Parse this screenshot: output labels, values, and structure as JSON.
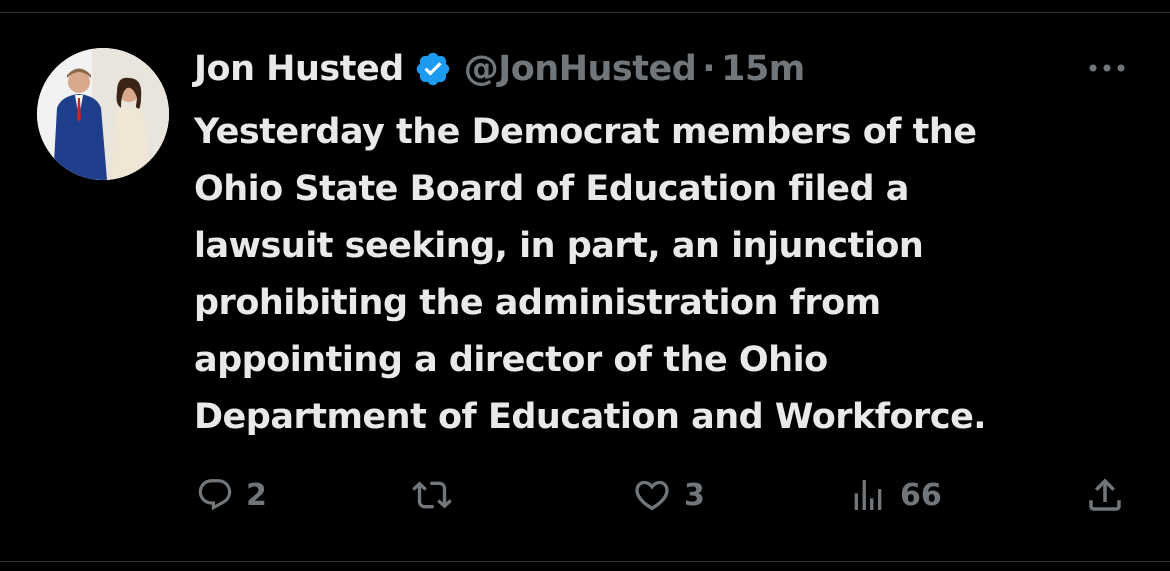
{
  "author": {
    "name": "Jon Husted",
    "handle": "@JonHusted",
    "separator": "·",
    "time": "15m",
    "verified": true,
    "verified_color": "#1d9bf0"
  },
  "tweet": {
    "lines": [
      "Yesterday the Democrat members of the",
      "Ohio State Board of Education filed a",
      "lawsuit seeking, in part, an injunction",
      "prohibiting the administration from",
      "appointing a director of the Ohio",
      "Department of Education and Workforce."
    ]
  },
  "actions": {
    "reply_count": "2",
    "retweet_count": "",
    "like_count": "3",
    "view_count": "66"
  },
  "icons": {
    "reply": "reply-icon",
    "retweet": "retweet-icon",
    "like": "heart-icon",
    "views": "views-icon",
    "share": "share-icon",
    "more": "more-icon",
    "verified": "verified-badge-icon"
  },
  "colors": {
    "background": "#000000",
    "text": "#e7e9ea",
    "muted": "#71767b",
    "accent": "#1d9bf0"
  }
}
